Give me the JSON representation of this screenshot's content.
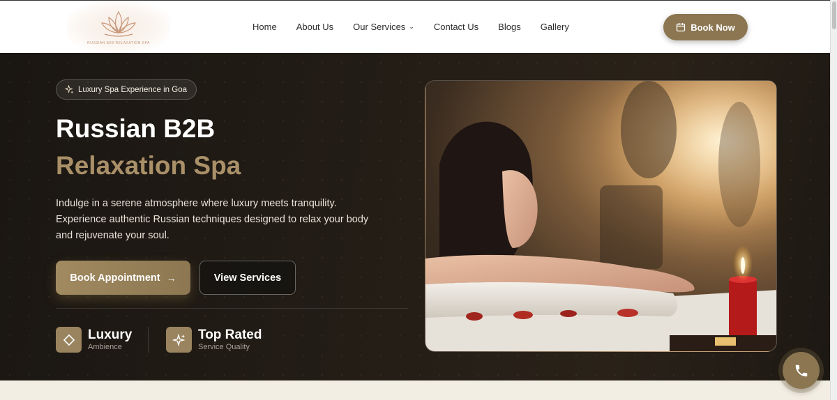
{
  "header": {
    "logo_alt_text": "RUSSIAN B2B RELAXATION SPA",
    "nav": [
      {
        "label": "Home"
      },
      {
        "label": "About Us"
      },
      {
        "label": "Our Services",
        "has_dropdown": true
      },
      {
        "label": "Contact Us"
      },
      {
        "label": "Blogs"
      },
      {
        "label": "Gallery"
      }
    ],
    "book_now_label": "Book Now"
  },
  "hero": {
    "badge": "Luxury Spa Experience in Goa",
    "title_line1": "Russian B2B",
    "title_line2": "Relaxation Spa",
    "description": "Indulge in a serene atmosphere where luxury meets tranquility. Experience authentic Russian techniques designed to relax your body and rejuvenate your soul.",
    "primary_button": "Book Appointment",
    "secondary_button": "View Services",
    "features": [
      {
        "title": "Luxury",
        "subtitle": "Ambience",
        "icon": "diamond-icon"
      },
      {
        "title": "Top Rated",
        "subtitle": "Service Quality",
        "icon": "sparkle-icon"
      }
    ]
  },
  "colors": {
    "accent": "#8b7651",
    "accent_text": "#a99068",
    "hero_bg": "#1e1913"
  },
  "icons": {
    "book_now": "calendar-icon",
    "primary_button": "arrow-right-icon",
    "badge": "sparkle-icon",
    "fab": "phone-icon"
  }
}
